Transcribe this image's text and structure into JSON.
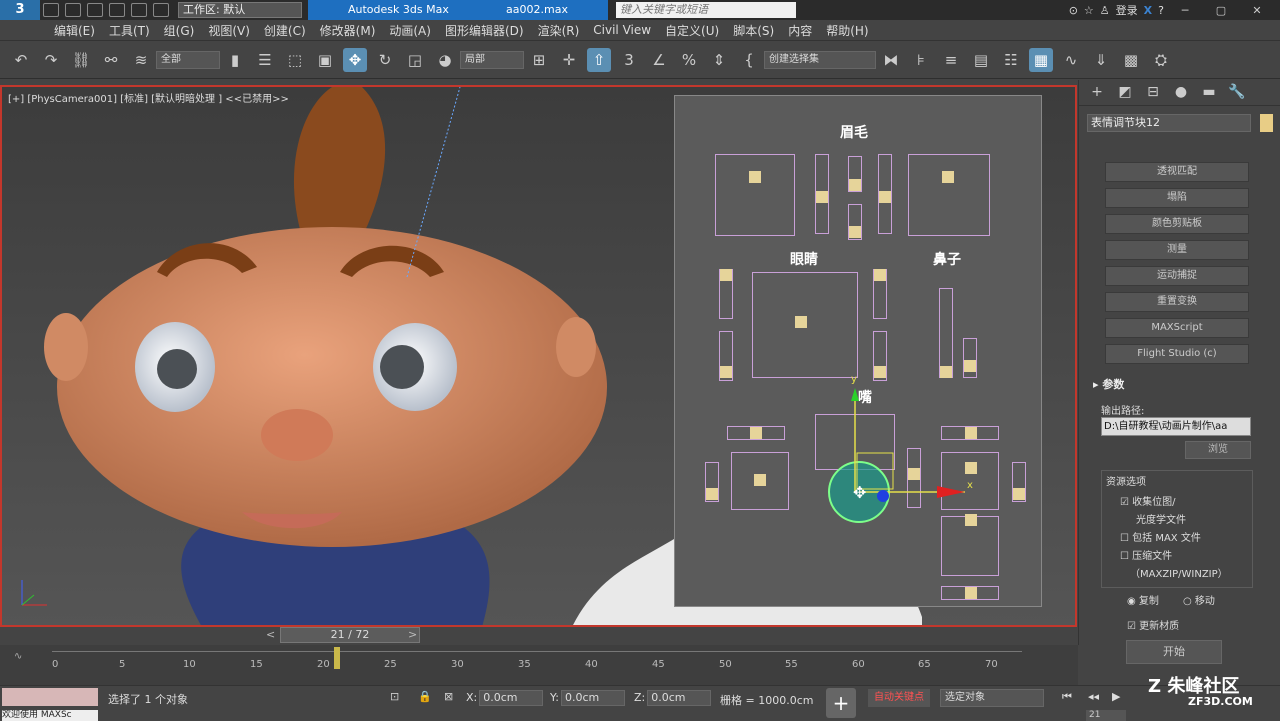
{
  "titlebar": {
    "logo": "3",
    "workspace": "工作区: 默认",
    "app": "Autodesk 3ds Max 2017",
    "file": "aa002.max",
    "search_placeholder": "键入关键字或短语",
    "login": "登录"
  },
  "menus": [
    "编辑(E)",
    "工具(T)",
    "组(G)",
    "视图(V)",
    "创建(C)",
    "修改器(M)",
    "动画(A)",
    "图形编辑器(D)",
    "渲染(R)",
    "Civil View",
    "自定义(U)",
    "脚本(S)",
    "内容",
    "帮助(H)"
  ],
  "toolbar": {
    "filter": "全部",
    "coord_system": "局部",
    "selection_set": "创建选择集"
  },
  "viewport": {
    "label": "[+] [PhysCamera001] [标准] [默认明暗处理 ] <<已禁用>>"
  },
  "panel": {
    "eyebrow": "眉毛",
    "eyes": "眼睛",
    "nose": "鼻子",
    "mouth": "嘴"
  },
  "command_panel": {
    "object_name": "表情调节块12",
    "buttons": [
      "透视匹配",
      "塌陷",
      "颜色剪贴板",
      "测量",
      "运动捕捉",
      "重置变换",
      "MAXScript",
      "Flight Studio (c)"
    ],
    "params_title": "参数",
    "output_label": "输出路径:",
    "output_path": "D:\\自研教程\\动画片制作\\aa",
    "browse": "浏览",
    "resources_title": "资源选项",
    "collect_bitmaps": "收集位图/",
    "photometric": "光度学文件",
    "include_max": "包括 MAX 文件",
    "compress": "压缩文件",
    "zip": "（MAXZIP/WINZIP）",
    "copy": "复制",
    "move": "移动",
    "update_materials": "更新材质",
    "start": "开始"
  },
  "time": {
    "current": "21 / 72",
    "ticks": [
      "0",
      "5",
      "10",
      "15",
      "20",
      "25",
      "30",
      "35",
      "40",
      "45",
      "50",
      "55",
      "60",
      "65",
      "70"
    ]
  },
  "status": {
    "maxscript": "欢迎使用 MAXSc",
    "selected": "选择了 1 个对象",
    "x_label": "X:",
    "x": "0.0cm",
    "y_label": "Y:",
    "y": "0.0cm",
    "z_label": "Z:",
    "z": "0.0cm",
    "grid": "栅格 = 1000.0cm",
    "auto_key": "自动关键点",
    "selected_objects": "选定对象",
    "frame": "21"
  },
  "watermark": {
    "name": "朱峰社区",
    "url": "ZF3D.COM"
  },
  "colors": {
    "accent": "#1e6fc0",
    "viewport_border": "#c3372c",
    "panel_rect": "#c9a0d8",
    "slider": "#e6d49a"
  }
}
